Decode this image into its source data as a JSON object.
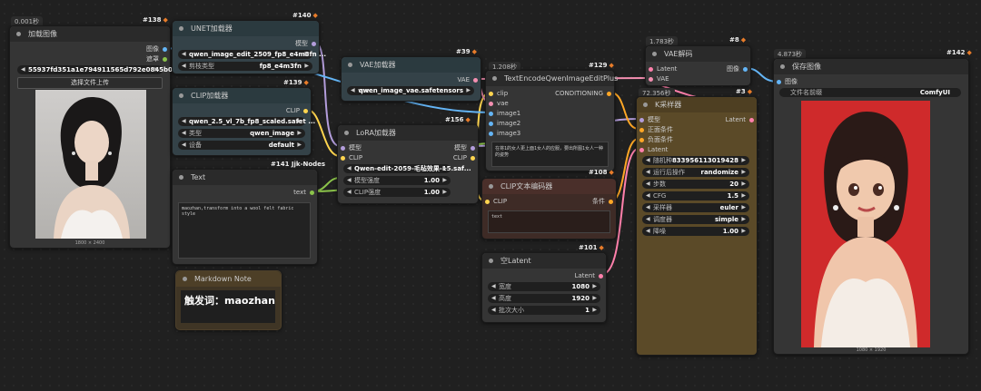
{
  "colors": {
    "accent": "#e87c2a",
    "wire_model": "#b39ddb",
    "wire_clip": "#ffd54f",
    "wire_vae": "#f48fb1",
    "wire_image": "#64b5f6",
    "wire_cond": "#ffa726",
    "wire_latent": "#ff80ab",
    "wire_text": "#8bc34a"
  },
  "load_image": {
    "timing": "0.001秒",
    "id": "#138",
    "title": "加载图像",
    "out_image": "图像",
    "out_mask": "遮罩",
    "filename": "55937fd351a1e794911565d792e0845b06 ...",
    "upload_label": "选择文件上传",
    "size": "1800 × 2400"
  },
  "unet": {
    "id": "#140",
    "title": "UNET加载器",
    "out": "模型",
    "w1_value": "qwen_image_edit_2509_fp8_e4m3fn ...",
    "w2_label": "剪枝类型",
    "w2_value": "fp8_e4m3fn"
  },
  "clip_loader": {
    "id": "#139",
    "title": "CLIP加载器",
    "out": "CLIP",
    "w1_value": "qwen_2.5_vl_7b_fp8_scaled.safet ...",
    "w2_label": "类型",
    "w2_value": "qwen_image",
    "w3_label": "设备",
    "w3_value": "default"
  },
  "text_node": {
    "id": "#141 Jjk-Nodes",
    "title": "Text",
    "out": "text",
    "value": "maozhan,transform into a wool felt fabric style"
  },
  "md_note": {
    "title": "Markdown Note",
    "content": "触发词：maozhan"
  },
  "vae_loader": {
    "id": "#39",
    "title": "VAE加载器",
    "out": "VAE",
    "w_label": "vae ...",
    "w_value": "qwen_image_vae.safetensors"
  },
  "lora": {
    "id": "#156",
    "title": "LoRA加载器",
    "in_model": "模型",
    "in_clip": "CLIP",
    "out_model": "模型",
    "out_clip": "CLIP",
    "w1_value": "Qwen-edit-2059-毛毡效果-15.saf...",
    "w2_label": "模型强度",
    "w2_value": "1.00",
    "w3_label": "CLIP强度",
    "w3_value": "1.00"
  },
  "encode_plus": {
    "timing": "1.208秒",
    "id": "#129",
    "title": "TextEncodeQwenImageEditPlus",
    "in1": "clip",
    "in2": "vae",
    "in3": "image1",
    "in4": "image2",
    "in5": "image3",
    "out": "CONDITIONING",
    "prompt": "在将1的女人更上面1女人的应服，要出所图1女人一种的姿势"
  },
  "clip_text": {
    "id": "#108",
    "title": "CLIP文本编码器",
    "in": "CLIP",
    "out": "条件",
    "placeholder": "text"
  },
  "empty_latent": {
    "id": "#101",
    "title": "空Latent",
    "out": "Latent",
    "w1_label": "宽度",
    "w1_value": "1080",
    "w2_label": "高度",
    "w2_value": "1920",
    "w3_label": "批次大小",
    "w3_value": "1"
  },
  "vae_decode": {
    "timing": "1.783秒",
    "id": "#8",
    "title": "VAE解码",
    "in1": "Latent",
    "in2": "VAE",
    "out": "图像"
  },
  "ksampler": {
    "timing": "72.356秒",
    "id": "#3",
    "title": "K采样器",
    "in1": "模型",
    "in2": "正面条件",
    "in3": "负面条件",
    "in4": "Latent",
    "out": "Latent",
    "widgets": [
      {
        "label": "随机种",
        "value": "833956113019428"
      },
      {
        "label": "运行后操作",
        "value": "randomize"
      },
      {
        "label": "步数",
        "value": "20"
      },
      {
        "label": "CFG",
        "value": "1.5"
      },
      {
        "label": "采样器",
        "value": "euler"
      },
      {
        "label": "调度器",
        "value": "simple"
      },
      {
        "label": "降噪",
        "value": "1.00"
      }
    ]
  },
  "save_image": {
    "timing": "4.873秒",
    "id": "#142",
    "title": "保存图像",
    "in": "图像",
    "w_label": "文件名前缀",
    "w_value": "ComfyUI",
    "size": "1080 × 1920"
  }
}
